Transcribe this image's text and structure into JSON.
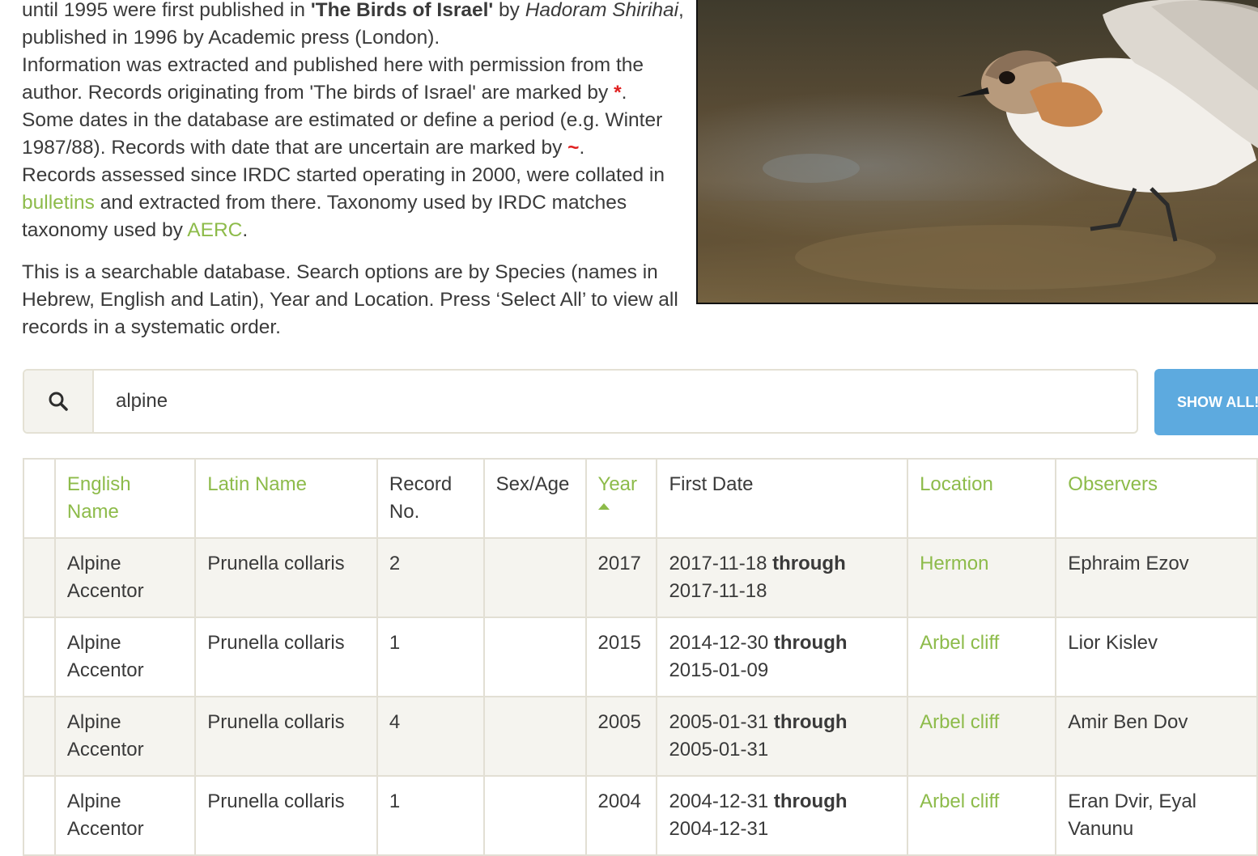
{
  "intro": {
    "p1_a": "until 1995 were first published in ",
    "p1_book": "'The Birds of Israel'",
    "p1_b": " by ",
    "p1_author": "Hadoram Shirihai",
    "p1_c": ",",
    "p2": "published in 1996 by Academic press (London).",
    "p3": "Information was extracted and published here with permission from the",
    "p4_a": "author. Records originating from 'The birds of Israel' are marked by ",
    "p4_mark": "*",
    "p4_b": ".",
    "p5": "Some dates in the database are estimated or define a period (e.g. Winter",
    "p6_a": "1987/88). Records with date that are uncertain are marked by ",
    "p6_mark": "~",
    "p6_b": ".",
    "p7": "Records assessed since IRDC started operating in 2000, were collated in",
    "p8_link": "bulletins",
    "p8_b": " and extracted from there. Taxonomy used by IRDC matches",
    "p9_a": "taxonomy used by ",
    "p9_link": "AERC",
    "p9_b": ".",
    "p10": "This is a searchable database. Search options are by Species (names in Hebrew, English and Latin), Year and Location. Press ‘Select All’ to view all records in a systematic order."
  },
  "search": {
    "value": "alpine",
    "icon": "search-icon",
    "show_all_label": "SHOW ALL!"
  },
  "table": {
    "headers": {
      "english_name": "English Name",
      "latin_name": "Latin Name",
      "record_no": "Record No.",
      "sex_age": "Sex/Age",
      "year": "Year",
      "first_date": "First Date",
      "location": "Location",
      "observers": "Observers"
    },
    "through_label": "through",
    "rows": [
      {
        "english": "Alpine Accentor",
        "latin": "Prunella collaris",
        "record": "2",
        "sexage": "",
        "year": "2017",
        "date_from": "2017-11-18",
        "date_to": "2017-11-18",
        "location": "Hermon",
        "observers": "Ephraim Ezov"
      },
      {
        "english": "Alpine Accentor",
        "latin": "Prunella collaris",
        "record": "1",
        "sexage": "",
        "year": "2015",
        "date_from": "2014-12-30",
        "date_to": "2015-01-09",
        "location": "Arbel cliff",
        "observers": "Lior Kislev"
      },
      {
        "english": "Alpine Accentor",
        "latin": "Prunella collaris",
        "record": "4",
        "sexage": "",
        "year": "2005",
        "date_from": "2005-01-31",
        "date_to": "2005-01-31",
        "location": "Arbel cliff",
        "observers": "Amir Ben Dov"
      },
      {
        "english": "Alpine Accentor",
        "latin": "Prunella collaris",
        "record": "1",
        "sexage": "",
        "year": "2004",
        "date_from": "2004-12-31",
        "date_to": "2004-12-31",
        "location": "Arbel cliff",
        "observers": "Eran Dvir, Eyal Vanunu"
      }
    ]
  },
  "colors": {
    "link": "#8dbb4a",
    "mark": "#e02020",
    "button": "#5daadf"
  }
}
